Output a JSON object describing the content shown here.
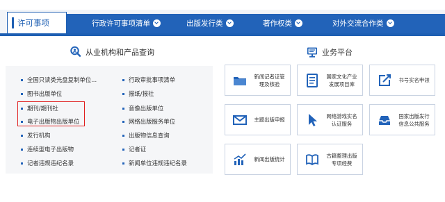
{
  "nav": {
    "active_tab": "许可事项",
    "items": [
      "行政许可事项清单",
      "出版发行类",
      "著作权类",
      "对外交流合作类"
    ]
  },
  "left": {
    "title": "从业机构和产品查询",
    "col1": [
      "全国只读类光盘复制单位...",
      "图书出版单位",
      "期刊/期刊社",
      "电子出版物出版单位",
      "发行机构",
      "连续型电子出版物",
      "记者违规违纪名录"
    ],
    "col2": [
      "行政审批事项清单",
      "报纸/报社",
      "音像出版单位",
      "网络出版服务单位",
      "出版物信息查询",
      "记者证",
      "新闻单位违规违纪名录"
    ]
  },
  "right": {
    "title": "业务平台",
    "cards": [
      "新闻记者证管理及核验",
      "国家文化产业发展项目库",
      "书号实名申领",
      "主题出版申报",
      "网络游戏实名认证服务",
      "国家出版发行信息公共服务",
      "新闻出版统计",
      "古籍整理出版专项经费"
    ]
  },
  "colors": {
    "brand_blue": "#2263b9",
    "highlight_red": "#e02020"
  }
}
